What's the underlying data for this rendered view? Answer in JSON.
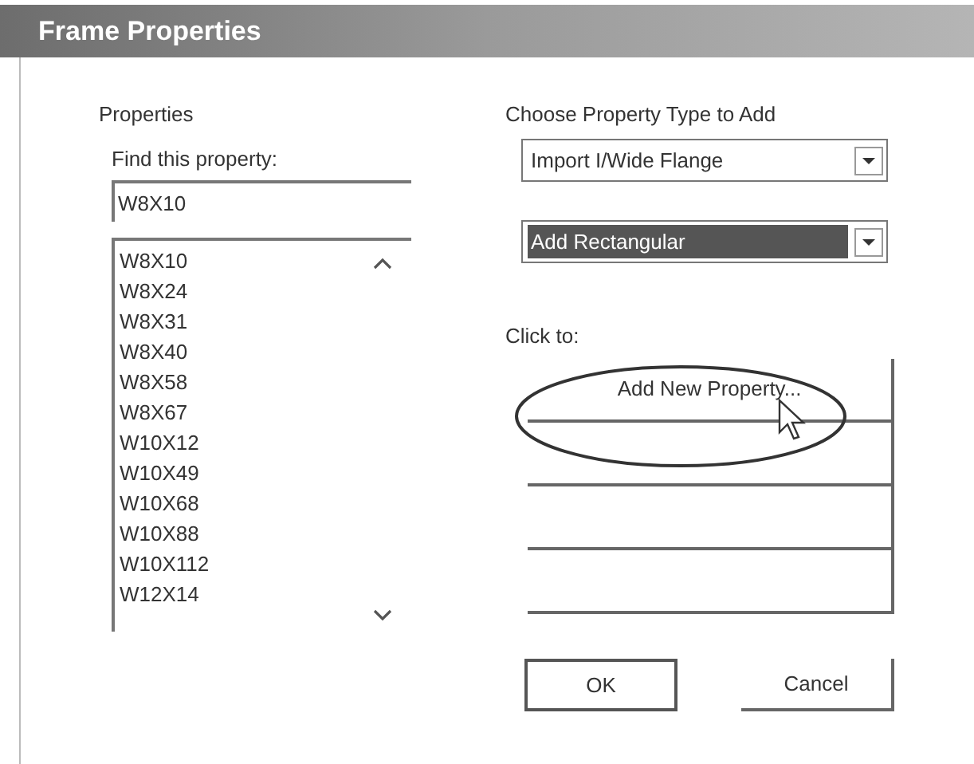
{
  "window": {
    "title": "Frame Properties"
  },
  "properties": {
    "label": "Properties",
    "find_label": "Find this property:",
    "find_value": "W8X10",
    "items": [
      {
        "label": "W8X10",
        "selected": false
      },
      {
        "label": "W8X24",
        "selected": false
      },
      {
        "label": "W8X31",
        "selected": false
      },
      {
        "label": "W8X40",
        "selected": false
      },
      {
        "label": "W8X58",
        "selected": false
      },
      {
        "label": "W8X67",
        "selected": false
      },
      {
        "label": "W10X12",
        "selected": false
      },
      {
        "label": "W10X49",
        "selected": false
      },
      {
        "label": "W10X68",
        "selected": false
      },
      {
        "label": "W10X88",
        "selected": false
      },
      {
        "label": "W10X112",
        "selected": false
      },
      {
        "label": "W12X14",
        "selected": false
      }
    ]
  },
  "add": {
    "label": "Choose Property Type to Add",
    "dropdowns": [
      {
        "value": "Import I/Wide Flange",
        "highlighted": false
      },
      {
        "value": "Add Rectangular",
        "highlighted": true
      }
    ],
    "click_label": "Click to:",
    "buttons": [
      {
        "kind": "labeled",
        "label": "Add New Property..."
      },
      {
        "kind": "blank"
      },
      {
        "kind": "blank"
      },
      {
        "kind": "blank"
      }
    ]
  },
  "footer_buttons": [
    "OK",
    "Cancel"
  ]
}
